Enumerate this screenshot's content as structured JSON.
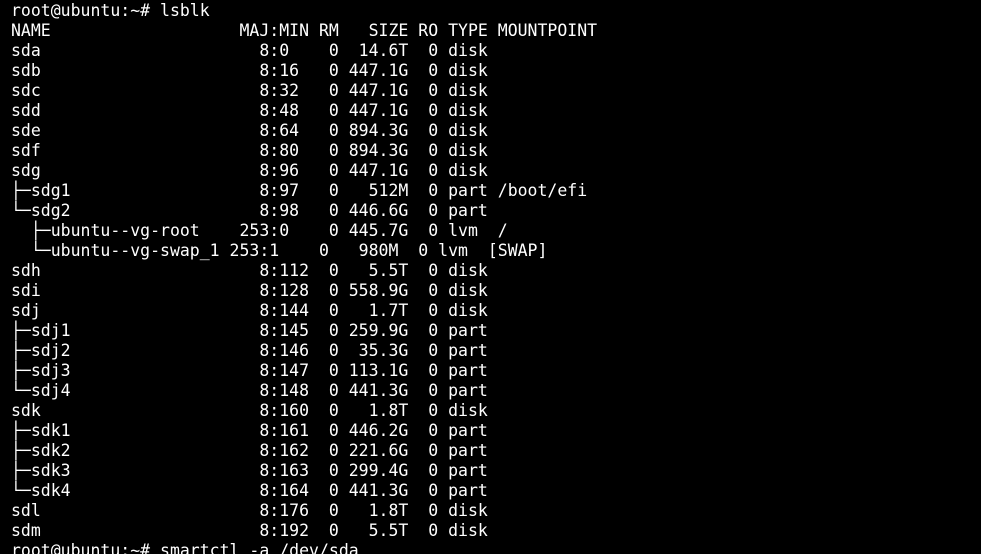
{
  "terminal": {
    "background_color": "#000000",
    "text_color": "#ffffff",
    "lines": [
      "root@ubuntu:~# lsblk",
      "NAME                   MAJ:MIN RM   SIZE RO TYPE MOUNTPOINT",
      "sda                      8:0    0  14.6T  0 disk",
      "sdb                      8:16   0 447.1G  0 disk",
      "sdc                      8:32   0 447.1G  0 disk",
      "sdd                      8:48   0 447.1G  0 disk",
      "sde                      8:64   0 894.3G  0 disk",
      "sdf                      8:80   0 894.3G  0 disk",
      "sdg                      8:96   0 447.1G  0 disk",
      "├─sdg1                   8:97   0   512M  0 part /boot/efi",
      "└─sdg2                   8:98   0 446.6G  0 part",
      "  ├─ubuntu--vg-root    253:0    0 445.7G  0 lvm  /",
      "  └─ubuntu--vg-swap_1 253:1    0   980M  0 lvm  [SWAP]",
      "sdh                      8:112  0   5.5T  0 disk",
      "sdi                      8:128  0 558.9G  0 disk",
      "sdj                      8:144  0   1.7T  0 disk",
      "├─sdj1                   8:145  0 259.9G  0 part",
      "├─sdj2                   8:146  0  35.3G  0 part",
      "├─sdj3                   8:147  0 113.1G  0 part",
      "└─sdj4                   8:148  0 441.3G  0 part",
      "sdk                      8:160  0   1.8T  0 disk",
      "├─sdk1                   8:161  0 446.2G  0 part",
      "├─sdk2                   8:162  0 221.6G  0 part",
      "├─sdk3                   8:163  0 299.4G  0 part",
      "└─sdk4                   8:164  0 441.3G  0 part",
      "sdl                      8:176  0   1.8T  0 disk",
      "sdm                      8:192  0   5.5T  0 disk"
    ],
    "partial_line": "root@ubuntu:~# smartctl -a /dev/sda"
  }
}
